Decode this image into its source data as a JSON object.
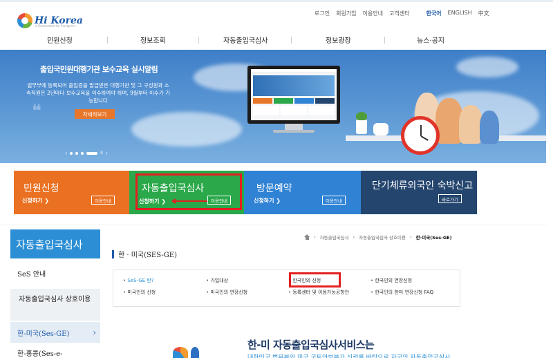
{
  "header": {
    "logo": "Hi Korea",
    "logo_sub": "e-Government for Foreigners",
    "util_links": [
      "로그인",
      "회원가입",
      "이용안내",
      "고객센터"
    ],
    "langs": [
      "한국어",
      "ENGLISH",
      "中文"
    ]
  },
  "gnb": [
    "민원신청",
    "정보조회",
    "자동출입국심사",
    "정보광장",
    "뉴스·공지"
  ],
  "banner": {
    "title": "출입국민원대행기관 보수교육 실시알림",
    "desc": "법무부에 등록되어 출입증을 발급받은 대행기관 및 그 구성원과 소속직원은 2년마다 보수교육을 이수하여야 하며, 9월부터 이수가 가능합니다",
    "button": "자세히보기",
    "pager_pause": "II",
    "pager_prev": "‹",
    "pager_next": "›"
  },
  "tiles": [
    {
      "title": "민원신청",
      "link": "신청하기 ❯",
      "btn": "이용안내"
    },
    {
      "title": "자동출입국심사",
      "link": "신청하기 ❯",
      "btn": "이용안내"
    },
    {
      "title": "방문예약",
      "link": "신청하기 ❯",
      "btn": "이용안내"
    },
    {
      "title": "단기체류외국인 숙박신고",
      "btn": "바로가기"
    }
  ],
  "lnb": {
    "title": "자동출입국심사",
    "items": [
      "SeS 안내",
      "자동출입국심사 상호이용",
      "한-미국(Ses-GE)",
      "한-홍콩(Ses-e-"
    ]
  },
  "breadcrumb": [
    "자동출입국심사",
    "자동출입국심사 상호이용",
    "한-미국(Ses-GE)"
  ],
  "page_title": "한 · 미국(SES-GE)",
  "subnav": [
    "SeS-GE 란?",
    "가입대상",
    "한국인의 신청",
    "한국인의 연장신청",
    "미국인의 신청",
    "미국인의 연장신청",
    "등록센터 및 이용가능공항안",
    "한국인의 한미 연장신청 FAQ"
  ],
  "promo": {
    "title": "한-미 자동출입국심사서비스는",
    "sub": "대한민국 법무부와 미국 국토안보부가 신뢰를 바탕으로 자국의 자동출입국심사"
  }
}
